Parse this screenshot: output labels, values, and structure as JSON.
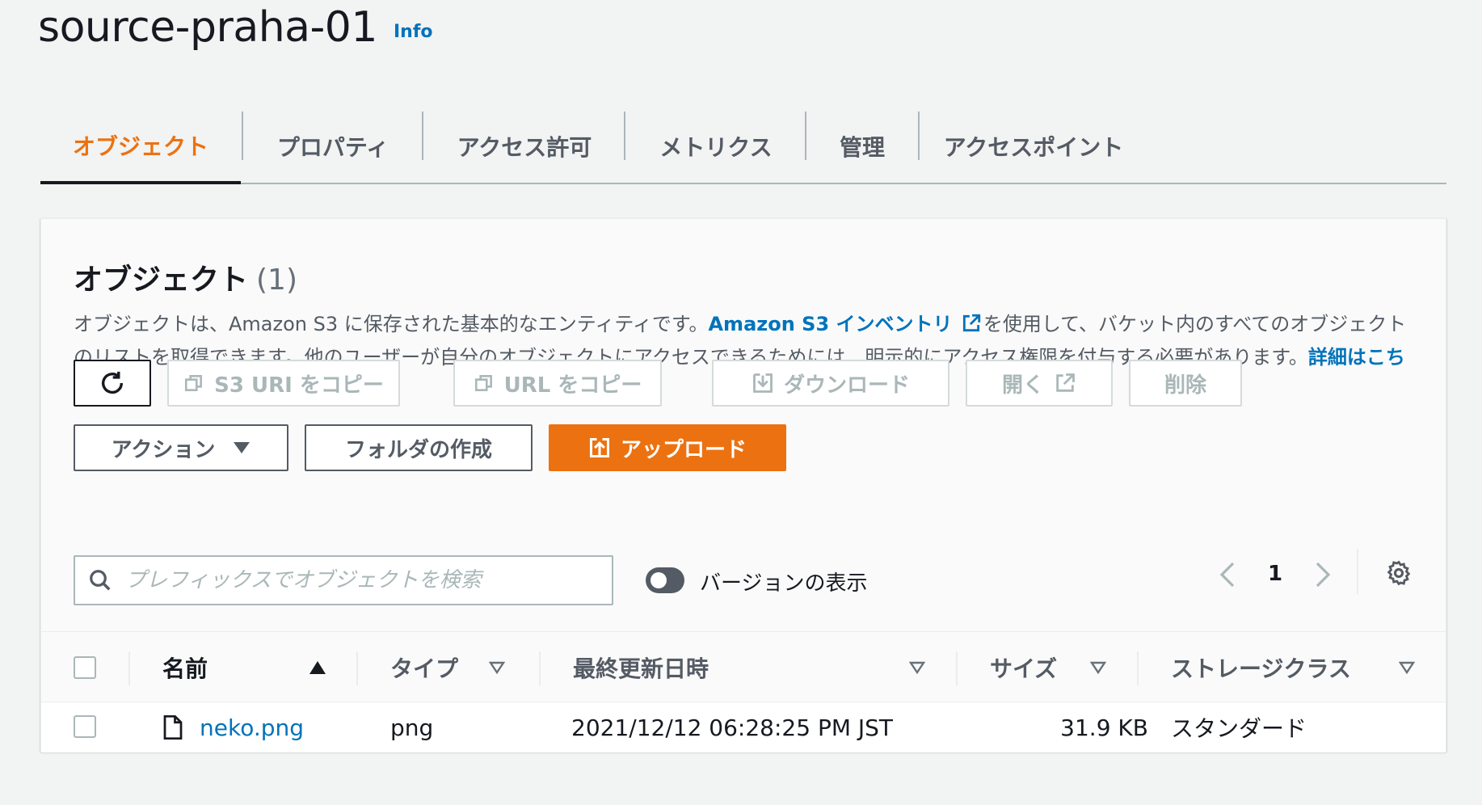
{
  "header": {
    "bucket_name": "source-praha-01",
    "info_label": "Info"
  },
  "tabs": [
    {
      "label": "オブジェクト",
      "active": true
    },
    {
      "label": "プロパティ",
      "active": false
    },
    {
      "label": "アクセス許可",
      "active": false
    },
    {
      "label": "メトリクス",
      "active": false
    },
    {
      "label": "管理",
      "active": false
    },
    {
      "label": "アクセスポイント",
      "active": false
    }
  ],
  "panel": {
    "heading": "オブジェクト",
    "count": "(1)",
    "desc_part1": "オブジェクトは、Amazon S3 に保存された基本的なエンティティです。",
    "desc_link1": "Amazon S3 インベントリ",
    "desc_part2": "を使用して、バケット内のすべてのオブジェクトのリストを取得できます。他のユーザーが自分のオブジェクトにアクセスできるためには、明示的にアクセス権限を付与する必要があります。",
    "desc_link2": "詳細はこちら"
  },
  "toolbar": {
    "copy_s3_uri": "S3 URI をコピー",
    "copy_url": "URL をコピー",
    "download": "ダウンロード",
    "open": "開く",
    "delete": "削除",
    "actions": "アクション",
    "create_folder": "フォルダの作成",
    "upload": "アップロード"
  },
  "search": {
    "placeholder": "プレフィックスでオブジェクトを検索"
  },
  "versions_toggle": {
    "label": "バージョンの表示",
    "on": false
  },
  "pagination": {
    "current_page": "1"
  },
  "table": {
    "columns": [
      "名前",
      "タイプ",
      "最終更新日時",
      "サイズ",
      "ストレージクラス"
    ],
    "rows": [
      {
        "name": "neko.png",
        "type": "png",
        "last_modified": "2021/12/12 06:28:25 PM JST",
        "size": "31.9 KB",
        "storage_class": "スタンダード"
      }
    ]
  },
  "colors": {
    "accent": "#ec7211",
    "link": "#0073bb",
    "text": "#16191f",
    "muted": "#545b64"
  }
}
